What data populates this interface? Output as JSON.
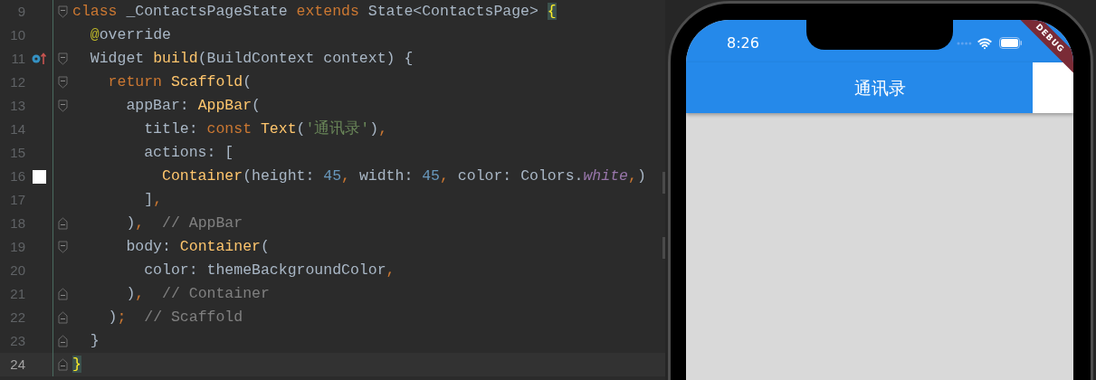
{
  "editor": {
    "lines": [
      {
        "number": "9",
        "selected": false,
        "fold_start": true,
        "fold_end": false,
        "overrides": false,
        "tokens": [
          {
            "kind": "keyword",
            "text": "class"
          },
          {
            "kind": "plain",
            "text": " _ContactsPageState "
          },
          {
            "kind": "keyword",
            "text": "extends"
          },
          {
            "kind": "plain",
            "text": " State<ContactsPage> "
          },
          {
            "kind": "brace",
            "text": "{"
          }
        ]
      },
      {
        "number": "10",
        "selected": false,
        "fold_start": false,
        "fold_end": false,
        "overrides": false,
        "tokens": [
          {
            "kind": "annotation",
            "text": "  @"
          },
          {
            "kind": "plain",
            "text": "override"
          }
        ]
      },
      {
        "number": "11",
        "selected": false,
        "fold_start": true,
        "fold_end": false,
        "overrides": true,
        "tokens": [
          {
            "kind": "plain",
            "text": "  Widget "
          },
          {
            "kind": "function",
            "text": "build"
          },
          {
            "kind": "plain",
            "text": "(BuildContext context) {"
          }
        ]
      },
      {
        "number": "12",
        "selected": false,
        "fold_start": true,
        "fold_end": false,
        "overrides": false,
        "tokens": [
          {
            "kind": "keyword",
            "text": "    return "
          },
          {
            "kind": "function",
            "text": "Scaffold"
          },
          {
            "kind": "plain",
            "text": "("
          }
        ]
      },
      {
        "number": "13",
        "selected": false,
        "fold_start": true,
        "fold_end": false,
        "overrides": false,
        "tokens": [
          {
            "kind": "plain",
            "text": "      appBar: "
          },
          {
            "kind": "function",
            "text": "AppBar"
          },
          {
            "kind": "plain",
            "text": "("
          }
        ]
      },
      {
        "number": "14",
        "selected": false,
        "fold_start": false,
        "fold_end": false,
        "overrides": false,
        "tokens": [
          {
            "kind": "plain",
            "text": "        title: "
          },
          {
            "kind": "keyword",
            "text": "const "
          },
          {
            "kind": "function",
            "text": "Text"
          },
          {
            "kind": "plain",
            "text": "("
          },
          {
            "kind": "string",
            "text": "'通讯录'"
          },
          {
            "kind": "plain",
            "text": ")"
          },
          {
            "kind": "punct",
            "text": ","
          }
        ]
      },
      {
        "number": "15",
        "selected": false,
        "fold_start": false,
        "fold_end": false,
        "overrides": false,
        "tokens": [
          {
            "kind": "plain",
            "text": "        actions: ["
          }
        ]
      },
      {
        "number": "16",
        "selected": false,
        "fold_start": false,
        "fold_end": false,
        "overrides": false,
        "color": "#ffffff",
        "tokens": [
          {
            "kind": "function",
            "text": "          Container"
          },
          {
            "kind": "plain",
            "text": "(height: "
          },
          {
            "kind": "number",
            "text": "45"
          },
          {
            "kind": "punct",
            "text": ","
          },
          {
            "kind": "plain",
            "text": " width: "
          },
          {
            "kind": "number",
            "text": "45"
          },
          {
            "kind": "punct",
            "text": ","
          },
          {
            "kind": "plain",
            "text": " color: Colors."
          },
          {
            "kind": "italic",
            "text": "white"
          },
          {
            "kind": "punct",
            "text": ","
          },
          {
            "kind": "plain",
            "text": ")"
          }
        ]
      },
      {
        "number": "17",
        "selected": false,
        "fold_start": false,
        "fold_end": false,
        "overrides": false,
        "tokens": [
          {
            "kind": "plain",
            "text": "        ]"
          },
          {
            "kind": "punct",
            "text": ","
          }
        ]
      },
      {
        "number": "18",
        "selected": false,
        "fold_start": false,
        "fold_end": true,
        "overrides": false,
        "tokens": [
          {
            "kind": "plain",
            "text": "      )"
          },
          {
            "kind": "punct",
            "text": ","
          },
          {
            "kind": "comment",
            "text": "  // AppBar"
          }
        ]
      },
      {
        "number": "19",
        "selected": false,
        "fold_start": true,
        "fold_end": false,
        "overrides": false,
        "tokens": [
          {
            "kind": "plain",
            "text": "      body: "
          },
          {
            "kind": "function",
            "text": "Container"
          },
          {
            "kind": "plain",
            "text": "("
          }
        ]
      },
      {
        "number": "20",
        "selected": false,
        "fold_start": false,
        "fold_end": false,
        "overrides": false,
        "tokens": [
          {
            "kind": "plain",
            "text": "        color: themeBackgroundColor"
          },
          {
            "kind": "punct",
            "text": ","
          }
        ]
      },
      {
        "number": "21",
        "selected": false,
        "fold_start": false,
        "fold_end": true,
        "overrides": false,
        "tokens": [
          {
            "kind": "plain",
            "text": "      )"
          },
          {
            "kind": "punct",
            "text": ","
          },
          {
            "kind": "comment",
            "text": "  // Container"
          }
        ]
      },
      {
        "number": "22",
        "selected": false,
        "fold_start": false,
        "fold_end": true,
        "overrides": false,
        "tokens": [
          {
            "kind": "plain",
            "text": "    )"
          },
          {
            "kind": "punct",
            "text": ";"
          },
          {
            "kind": "comment",
            "text": "  // Scaffold"
          }
        ]
      },
      {
        "number": "23",
        "selected": false,
        "fold_start": false,
        "fold_end": true,
        "overrides": false,
        "tokens": [
          {
            "kind": "plain",
            "text": "  }"
          }
        ]
      },
      {
        "number": "24",
        "selected": true,
        "fold_start": false,
        "fold_end": true,
        "overrides": false,
        "tokens": [
          {
            "kind": "brace",
            "text": "}"
          }
        ]
      }
    ]
  },
  "phone": {
    "status_bar": {
      "time": "8:26"
    },
    "app_bar": {
      "title": "通讯录"
    },
    "debug_banner": "DEBUG"
  }
}
